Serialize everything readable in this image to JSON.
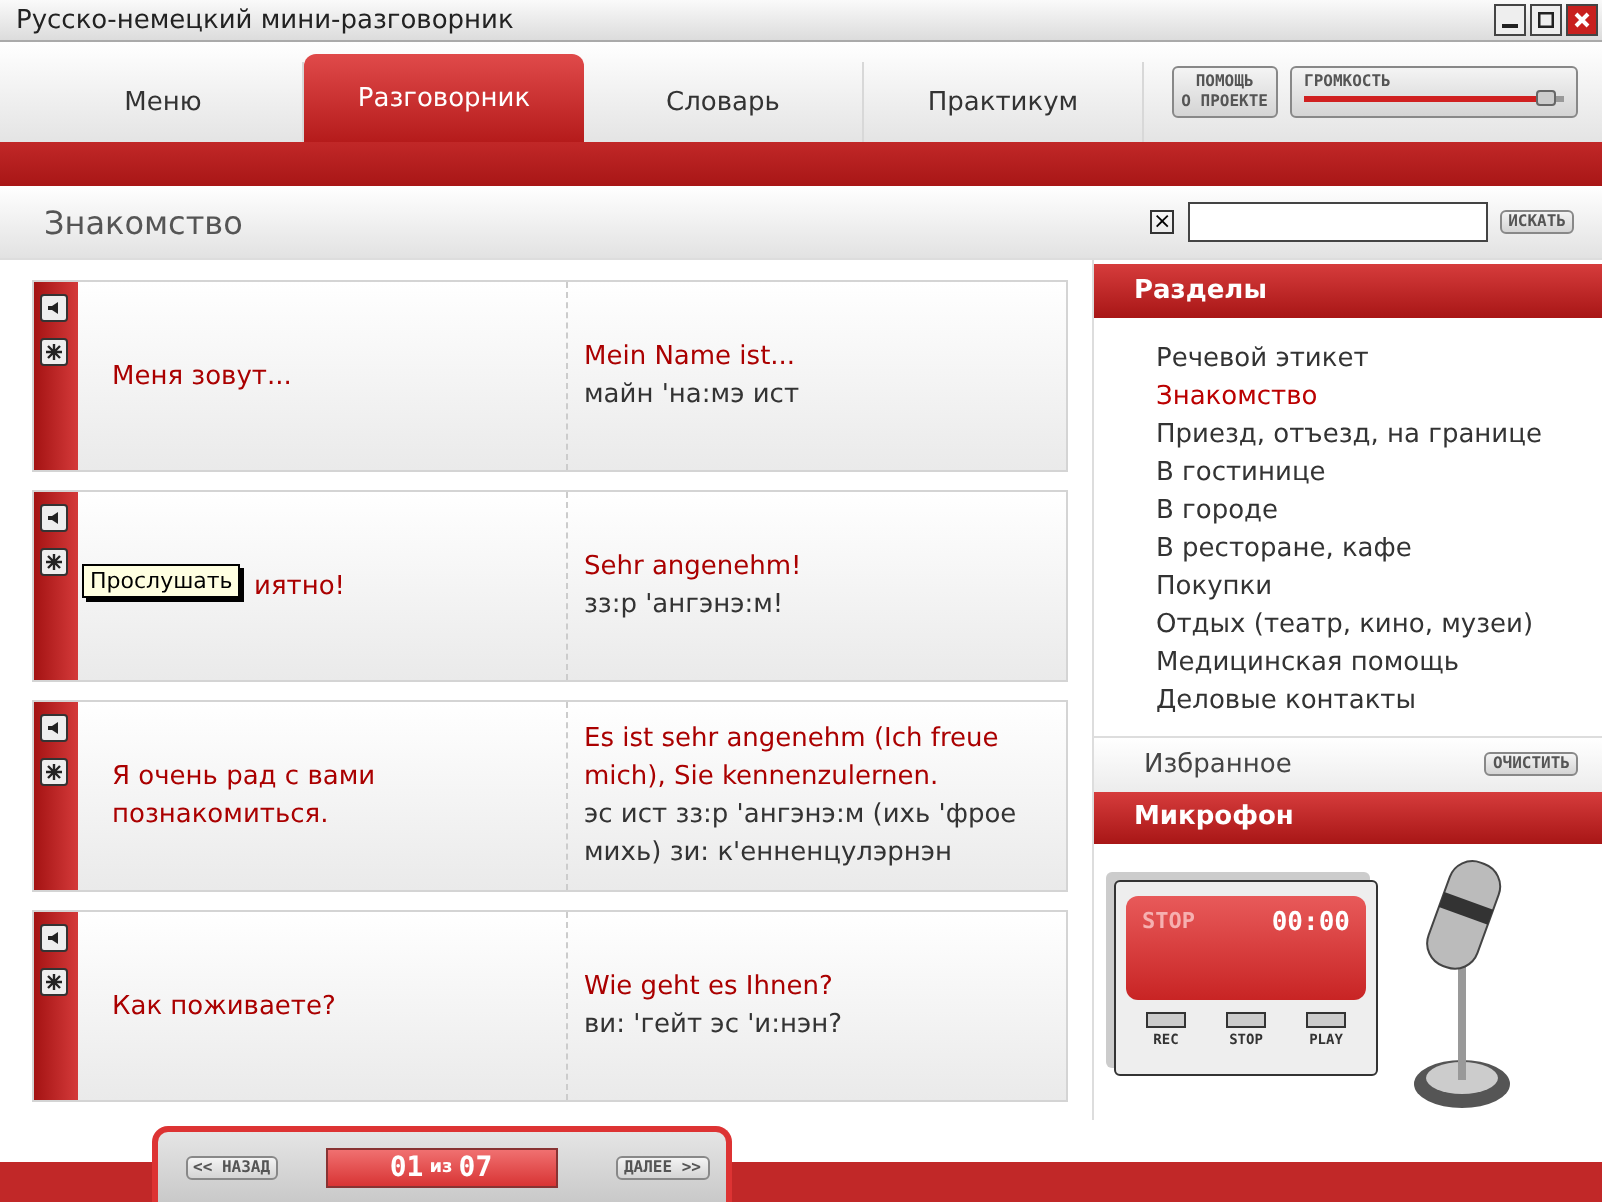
{
  "window": {
    "title": "Русско-немецкий мини-разговорник"
  },
  "tabs": [
    {
      "label": "Меню",
      "selected": false
    },
    {
      "label": "Разговорник",
      "selected": true
    },
    {
      "label": "Словарь",
      "selected": false
    },
    {
      "label": "Практикум",
      "selected": false
    }
  ],
  "about_button": [
    "ПОМОЩЬ",
    "О ПРОЕКТЕ"
  ],
  "volume": {
    "label": "ГРОМКОСТЬ",
    "level": 0.97
  },
  "section_title": "Знакомство",
  "search": {
    "clear": "×",
    "button": "ИСКАТЬ"
  },
  "phrases": [
    {
      "ru": "Меня зовут...",
      "de": "Mein Name ist...",
      "transcription": "майн 'на:мэ ист"
    },
    {
      "ru": "иятно!",
      "de": "Sehr angenehm!",
      "transcription": "зз:р 'ангэнэ:м!",
      "tooltip": "Прослушать"
    },
    {
      "ru": "Я очень рад с вами познакомиться.",
      "de": "Es ist sehr angenehm (Ich freue mich), Sie kennenzulernen.",
      "transcription": "эс ист зз:р 'ангэнэ:м (ихь 'фрое михь) зи: к'енненцулэрнэн"
    },
    {
      "ru": "Как поживаете?",
      "de": "Wie geht es Ihnen?",
      "transcription": "ви: 'гейт эс 'и:нэн?"
    }
  ],
  "sections": {
    "title": "Разделы",
    "items": [
      {
        "label": "Речевой этикет",
        "selected": false
      },
      {
        "label": "Знакомство",
        "selected": true
      },
      {
        "label": "Приезд, отъезд, на границе",
        "selected": false
      },
      {
        "label": "В гостинице",
        "selected": false
      },
      {
        "label": "В городе",
        "selected": false
      },
      {
        "label": "В ресторане, кафе",
        "selected": false
      },
      {
        "label": "Покупки",
        "selected": false
      },
      {
        "label": "Отдых (театр, кино, музеи)",
        "selected": false
      },
      {
        "label": "Медицинская помощь",
        "selected": false
      },
      {
        "label": "Деловые контакты",
        "selected": false
      }
    ]
  },
  "favorites": {
    "label": "Избранное",
    "button": "ОЧИСТИТЬ"
  },
  "microphone": {
    "title": "Микрофон",
    "status": "STOP",
    "time": "00:00",
    "controls": [
      "REC",
      "STOP",
      "PLAY"
    ]
  },
  "pager": {
    "prev": "<< НАЗАД",
    "current": "01",
    "of": "из",
    "total": "07",
    "next": "ДАЛЕЕ >>"
  }
}
